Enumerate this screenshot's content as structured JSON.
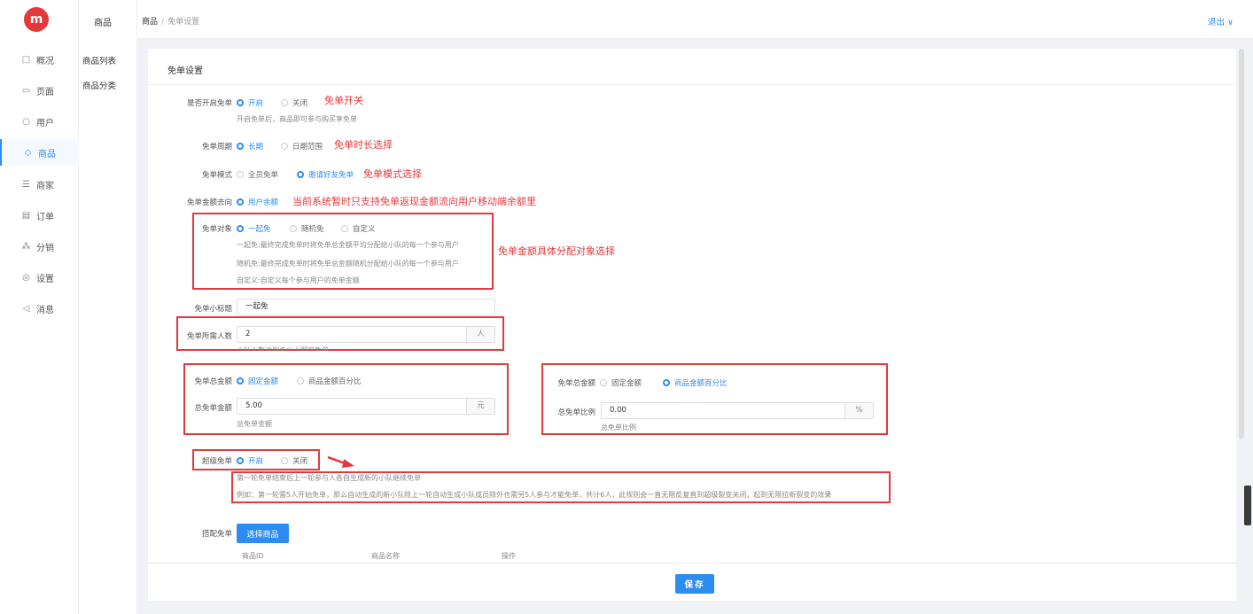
{
  "logo": "m",
  "nav": [
    {
      "icon": "□",
      "label": "概况"
    },
    {
      "icon": "▭",
      "label": "页面"
    },
    {
      "icon": "○",
      "label": "用户"
    },
    {
      "icon": "◇",
      "label": "商品"
    },
    {
      "icon": "☰",
      "label": "商家"
    },
    {
      "icon": "▤",
      "label": "订单"
    },
    {
      "icon": "⁂",
      "label": "分销"
    },
    {
      "icon": "◎",
      "label": "设置"
    },
    {
      "icon": "◁",
      "label": "消息"
    }
  ],
  "subnav": {
    "title": "商品",
    "items": [
      "商品列表",
      "商品分类"
    ]
  },
  "breadcrumb": {
    "root": "商品",
    "sep": "/",
    "current": "免单设置"
  },
  "logout": "退出 ∨",
  "card_title": "免单设置",
  "form": {
    "enable": {
      "label": "是否开启免单",
      "on": "开启",
      "off": "关闭",
      "hint": "开启免单后，商品即可参与购买享免单",
      "note": "免单开关"
    },
    "period": {
      "label": "免单周期",
      "a": "长期",
      "b": "日期范围",
      "note": "免单时长选择"
    },
    "mode": {
      "label": "免单模式",
      "a": "全员免单",
      "b": "邀请好友免单",
      "note": "免单模式选择"
    },
    "destination": {
      "label": "免单金额去向",
      "a": "用户余额",
      "note": "当前系统暂时只支持免单返现金额流向用户移动端余额里"
    },
    "target": {
      "label": "免单对象",
      "a": "一起免",
      "b": "随机免",
      "c": "自定义",
      "hints": [
        "一起免:最终完成免单时将免单总金额平均分配给小队的每一个参与用户",
        "随机免:最终完成免单时将免单总金额随机分配给小队的每一个参与用户",
        "自定义:自定义每个参与用户的免单金额"
      ],
      "note": "免单金额具体分配对象选择"
    },
    "subtitle": {
      "label": "免单小标题",
      "value": "一起免"
    },
    "people": {
      "label": "免单所需人数",
      "value": "2",
      "suffix": "人",
      "hint": "小队人数达到多少人即可免单"
    },
    "total_left": {
      "label": "免单总金额",
      "a": "固定金额",
      "b": "商品金额百分比",
      "amount_label": "总免单金额",
      "amount": "5.00",
      "suffix": "元",
      "hint": "总免单金额"
    },
    "total_right": {
      "label": "免单总金额",
      "a": "固定金额",
      "b": "商品金额百分比",
      "ratio_label": "总免单比例",
      "ratio": "0.00",
      "suffix": "%",
      "hint": "总免单比例"
    },
    "super": {
      "label": "超级免单",
      "on": "开启",
      "off": "关闭",
      "hint1": "第一轮免单结束后上一轮参与人各自生成新的小队继续免单",
      "hint2": "例如：第一轮需5人开始免单，那么自动生成的新小队除上一轮自动生成小队成员除外也需另5人参与才能免单，共计6人，此规则会一直无限反复直到超级裂变关闭，起到无限拉新裂变的效果"
    },
    "match": {
      "label": "搭配免单",
      "button": "选择商品",
      "cols": [
        "商品ID",
        "商品名称",
        "操作"
      ]
    }
  },
  "save": "保存"
}
